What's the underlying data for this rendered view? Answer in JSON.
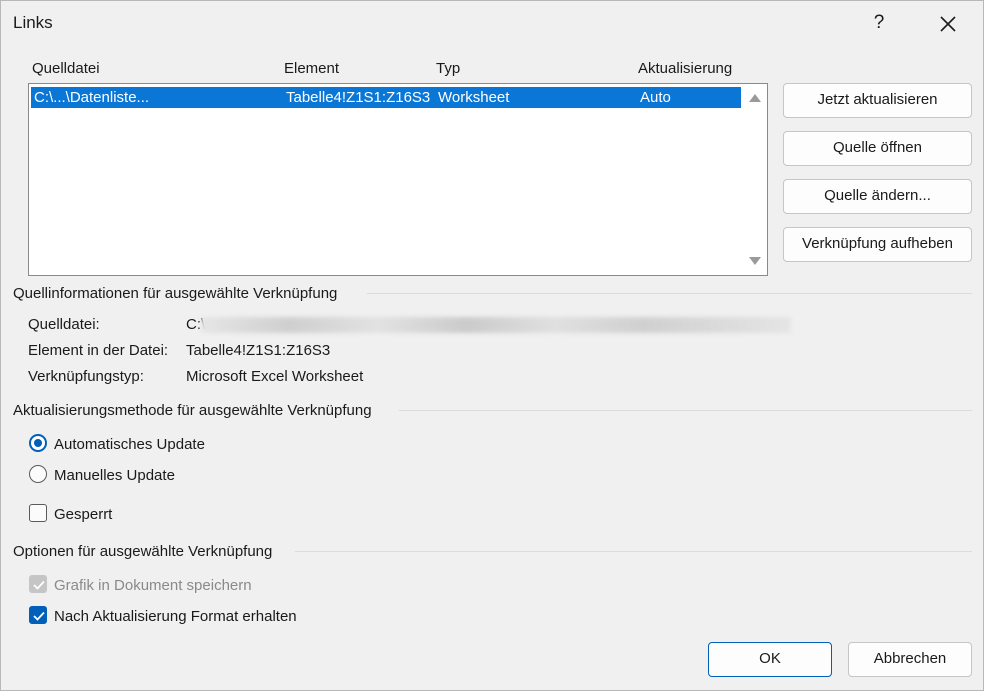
{
  "window": {
    "title": "Links",
    "help_label": "?"
  },
  "list": {
    "headers": {
      "source": "Quelldatei",
      "element": "Element",
      "type": "Typ",
      "update": "Aktualisierung"
    },
    "rows": [
      {
        "source": "C:\\...\\Datenliste...",
        "element": "Tabelle4!Z1S1:Z16S3",
        "type": "Worksheet",
        "update": "Auto"
      }
    ]
  },
  "buttons": {
    "update_now": "Jetzt aktualisieren",
    "open_source": "Quelle öffnen",
    "change_source": "Quelle ändern...",
    "break_link": "Verknüpfung aufheben",
    "ok": "OK",
    "cancel": "Abbrechen"
  },
  "source_info": {
    "heading": "Quellinformationen für ausgewählte Verknüpfung",
    "source_label": "Quelldatei:",
    "source_value": "C:\\",
    "element_label": "Element in der Datei:",
    "element_value": "Tabelle4!Z1S1:Z16S3",
    "type_label": "Verknüpfungstyp:",
    "type_value": "Microsoft Excel Worksheet"
  },
  "update_method": {
    "heading": "Aktualisierungsmethode für ausgewählte Verknüpfung",
    "automatic": "Automatisches Update",
    "manual": "Manuelles Update",
    "locked": "Gesperrt",
    "selected": "automatic",
    "locked_checked": false
  },
  "options": {
    "heading": "Optionen für ausgewählte Verknüpfung",
    "save_graphic": "Grafik in Dokument speichern",
    "save_graphic_checked": true,
    "save_graphic_disabled": true,
    "keep_format": "Nach Aktualisierung Format erhalten",
    "keep_format_checked": true
  },
  "colors": {
    "accent": "#005fb8",
    "selection": "#0a76d6"
  }
}
